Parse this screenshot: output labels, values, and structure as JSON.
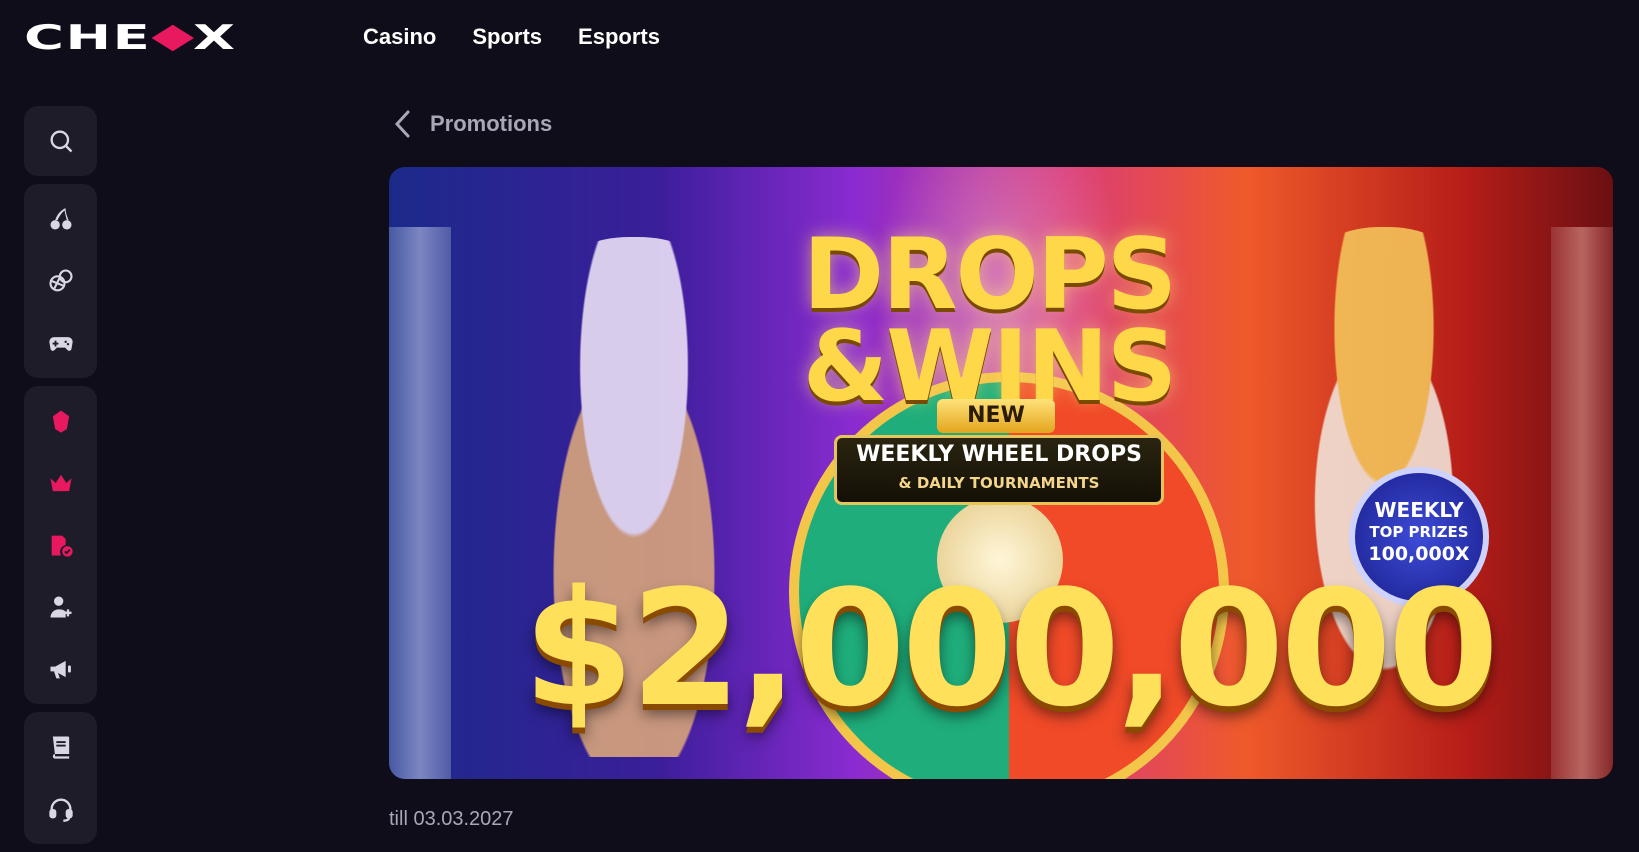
{
  "header": {
    "logo_text_left": "CHE",
    "logo_text_right": "X",
    "nav": [
      "Casino",
      "Sports",
      "Esports"
    ]
  },
  "sidebar": {
    "groups": [
      [
        {
          "icon": "search-icon"
        }
      ],
      [
        {
          "icon": "cherries-icon"
        },
        {
          "icon": "sports-balls-icon"
        },
        {
          "icon": "gamepad-icon"
        }
      ],
      [
        {
          "icon": "gift-icon"
        },
        {
          "icon": "crown-icon"
        },
        {
          "icon": "ticket-check-icon"
        },
        {
          "icon": "add-user-icon"
        },
        {
          "icon": "megaphone-icon"
        }
      ],
      [
        {
          "icon": "book-icon"
        },
        {
          "icon": "headset-icon"
        }
      ]
    ]
  },
  "page": {
    "back_label": "Promotions",
    "validity": "till 03.03.2027"
  },
  "banner": {
    "headline_line1": "DROPS",
    "headline_line2": "&WINS",
    "new_badge": "NEW",
    "plate_line1": "WEEKLY WHEEL DROPS",
    "plate_line2": "& DAILY TOURNAMENTS",
    "medal_line1": "WEEKLY",
    "medal_line2": "TOP PRIZES",
    "medal_line3": "100,000X",
    "prize": "$2,000,000"
  },
  "colors": {
    "background": "#100d1a",
    "sidebar_group": "#1f1c2a",
    "accent_pink": "#e8195e",
    "muted_text": "#a9a6b7"
  }
}
